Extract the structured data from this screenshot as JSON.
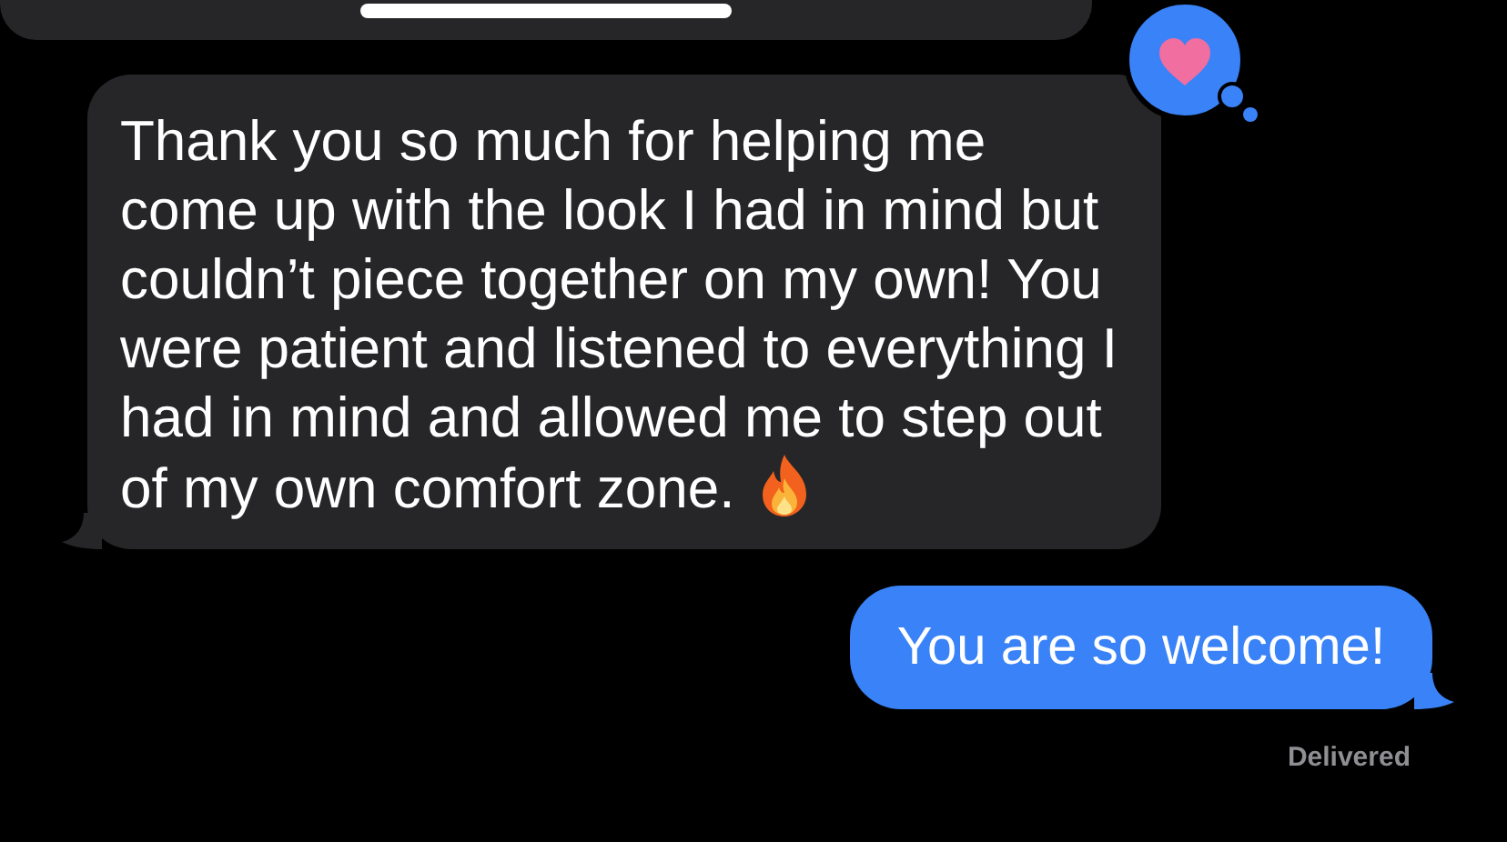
{
  "messages": [
    {
      "kind": "received",
      "text": "Thank you so much for helping me come up with the look I had in mind but couldn’t piece together on my own! You were patient and listened to everything I had in mind and allowed me to step out of my own comfort zone.",
      "fire_emoji": true,
      "heart_reaction": true
    },
    {
      "kind": "sent",
      "text": "You are so welcome!"
    }
  ],
  "status": "Delivered"
}
